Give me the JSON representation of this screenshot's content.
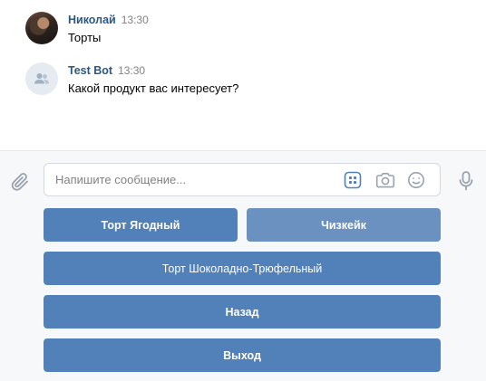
{
  "messages": [
    {
      "author": "Николай",
      "time": "13:30",
      "text": "Торты",
      "avatar": "user-photo"
    },
    {
      "author": "Test Bot",
      "time": "13:30",
      "text": "Какой продукт вас интересует?",
      "avatar": "group-icon"
    }
  ],
  "composer": {
    "placeholder": "Напишите сообщение...",
    "icons": [
      "paperclip-icon",
      "keyboard-icon",
      "camera-icon",
      "smile-icon",
      "microphone-icon"
    ]
  },
  "keyboard": {
    "buttons": [
      {
        "label": "Торт Ягодный"
      },
      {
        "label": "Чизкейк"
      },
      {
        "label": "Торт Шоколадно-Трюфельный"
      },
      {
        "label": "Назад"
      },
      {
        "label": "Выход"
      }
    ]
  },
  "colors": {
    "accent": "#5181b8",
    "button_secondary": "#6b91c0",
    "author": "#2a5885",
    "muted": "#828282",
    "composer_bg": "#f7f8fa"
  }
}
